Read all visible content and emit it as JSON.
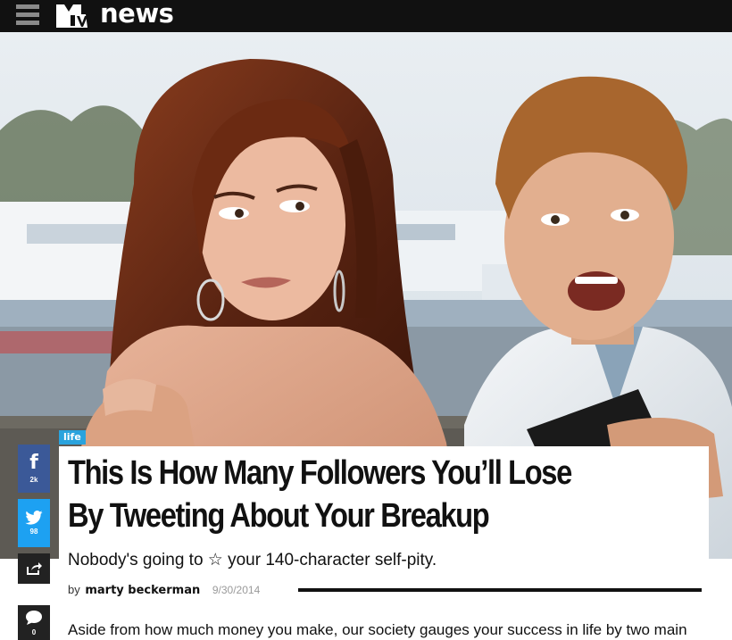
{
  "site": {
    "brand": "news"
  },
  "category": "life",
  "article": {
    "headline_line1": "This Is How Many Followers You’ll Lose",
    "headline_line2": "By Tweeting About Your Breakup",
    "dek": "Nobody's going to ☆ your 140-character self-pity.",
    "byline_prefix": "by",
    "author": "marty beckerman",
    "date": "9/30/2014",
    "body_start": "Aside from how much money you make, our society gauges your success in life by two main"
  },
  "share": {
    "facebook_count": "2k",
    "twitter_count": "98",
    "comment_count": "0"
  },
  "colors": {
    "topbar": "#111111",
    "facebook": "#3b5998",
    "twitter": "#1da1f2",
    "category_badge": "#2aa3dd",
    "dark_button": "#222222"
  },
  "icons": [
    "menu-icon",
    "mtv-logo",
    "facebook-icon",
    "twitter-icon",
    "share-icon",
    "comment-icon"
  ]
}
